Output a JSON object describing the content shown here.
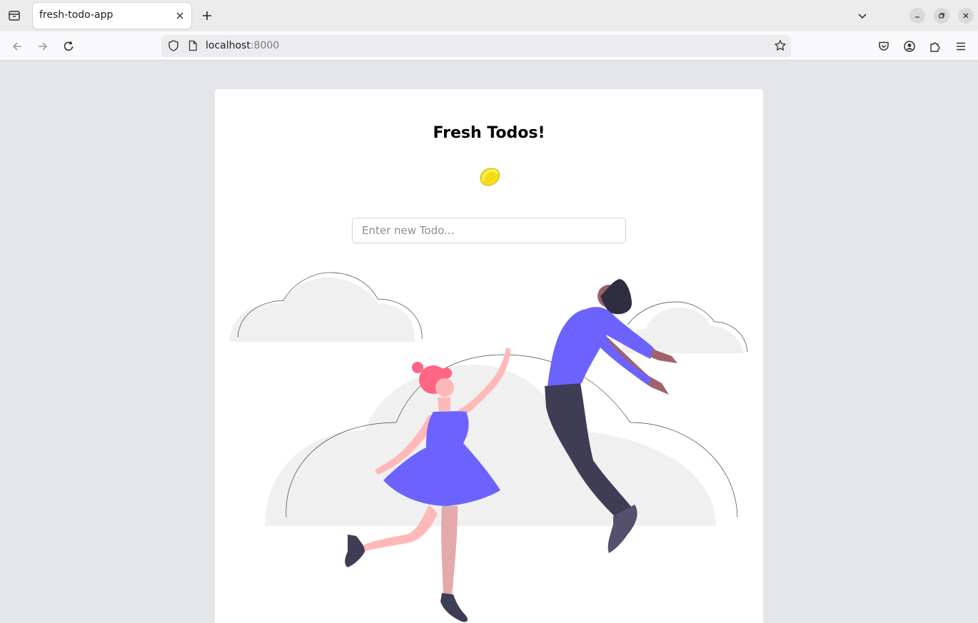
{
  "browser": {
    "tab_title": "fresh-todo-app",
    "url_host": "localhost",
    "url_port": ":8000"
  },
  "page": {
    "title": "Fresh Todos!",
    "input_placeholder": "Enter new Todo..."
  },
  "icons": {
    "logo": "lemon-icon",
    "tab_list": "tab-list-icon",
    "close": "close-icon",
    "new_tab": "plus-icon",
    "back": "arrow-left-icon",
    "forward": "arrow-right-icon",
    "reload": "reload-icon",
    "shield": "shield-icon",
    "page": "page-icon",
    "bookmark": "star-icon",
    "pocket": "pocket-icon",
    "account": "account-icon",
    "extensions": "puzzle-icon",
    "menu": "hamburger-menu-icon"
  },
  "colors": {
    "page_background": "#e4e5e9",
    "card": "#ffffff",
    "accent": "#6c63ff",
    "lemon": "#f7e01a"
  }
}
